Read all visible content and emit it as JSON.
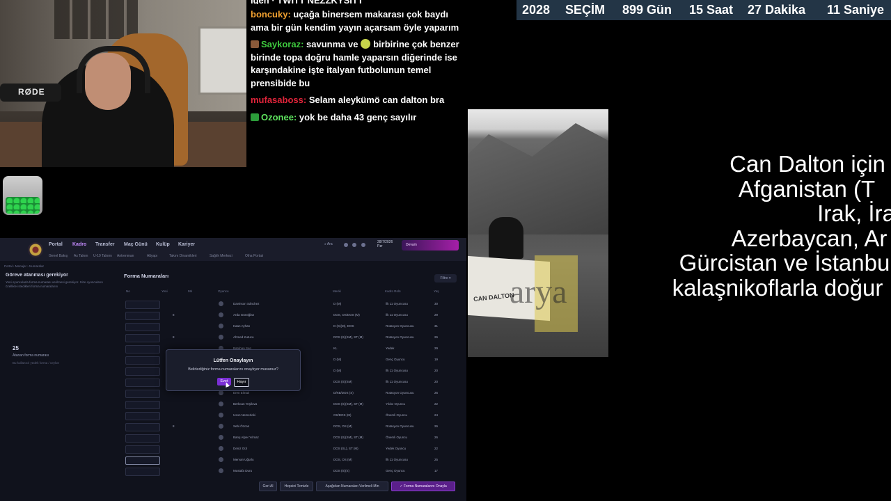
{
  "chat": {
    "messages": [
      {
        "user": "boncuky:",
        "text": "uçağa binersem makarası çok baydı ama bir gün kendim yayın açarsam öyle yaparım",
        "color": "#f0a030",
        "badge": ""
      },
      {
        "user": "Saykoraz:",
        "text": "savunma ve",
        "text2": "birbirine çok benzer birinde topa doğru hamle yaparsın diğerinde ise karşındakine işte italyan futbolunun temel prensibide bu",
        "color": "#3ec93e",
        "badge": "#8a5a3a"
      },
      {
        "user": "mufasaboss:",
        "text": "Selam aleykümö can dalton bra",
        "color": "#e0243a",
        "badge": ""
      },
      {
        "user": "Ozonee:",
        "text": "yok be daha 43 genç sayılır",
        "color": "#5ee35e",
        "badge": "#2c9c3a"
      }
    ]
  },
  "game": {
    "nav": [
      "Portal",
      "Kadro",
      "Transfer",
      "Maç Günü",
      "Kulüp",
      "Kariyer"
    ],
    "subnav": [
      "Genel Bakış",
      "As Takım",
      "U-19 Takımı",
      "Antrenman",
      "Altyapı",
      "Takım Dinamikleri",
      "Sağlık Merkezi",
      "Oiha Portalı"
    ],
    "search_label": "Ara",
    "date": "28/7/2026",
    "date_sub": "Pzr",
    "progress_label": "Devam",
    "breadcrumb": "Portal › Menajer › Numaralar",
    "left_title": "Göreve atanması gerekiyor",
    "left_desc": "Yeni oyuncularla forma numarası verilmesi gerekiyor. Size oyuncuların özellikle istedikleri forma numaralarını",
    "left_number": "25",
    "left_number_label": "Atanan forma numarası",
    "left_note": "Bu kullanıcıl yedek forma / ceylon",
    "table_title": "Forma Numaraları",
    "filter_label": "Filtre",
    "columns": [
      "No",
      "Yeni",
      "Mk",
      "Oyuncu",
      "Mevki",
      "Kadro Rolü",
      "Yaş"
    ],
    "rows": [
      {
        "name": "Davinson Sánchez",
        "pos": "D (M)",
        "role": "İlk 11 Oyuncusu",
        "age": "30",
        "mk": ""
      },
      {
        "name": "Arda Günöğlan",
        "pos": "DOS, OS/DOS (M)",
        "role": "İlk 11 Oyuncusu",
        "age": "29",
        "mk": "8"
      },
      {
        "name": "Kaan Ayhan",
        "pos": "D (S)(M), DOS",
        "role": "Rotasyon Oyuncusu",
        "age": "31",
        "mk": ""
      },
      {
        "name": "Ahmed Kutucu",
        "pos": "DOS (S)(SM), ST (M)",
        "role": "Rotasyon Oyuncusu",
        "age": "26",
        "mk": "8"
      },
      {
        "name": "Batuhan Şen",
        "pos": "KL",
        "role": "Yedek",
        "age": "29",
        "mk": ""
      },
      {
        "name": "Oyuncu",
        "pos": "D (M)",
        "role": "Genç Oyuncu",
        "age": "19",
        "mk": ""
      },
      {
        "name": "Oyuncu",
        "pos": "D (M)",
        "role": "İlk 11 Oyuncusu",
        "age": "20",
        "mk": ""
      },
      {
        "name": "Oyuncu",
        "pos": "DOS (S)(SM)",
        "role": "İlk 11 Oyuncusu",
        "age": "20",
        "mk": ""
      },
      {
        "name": "Eren Elmalı",
        "pos": "D/KB/DOS (S)",
        "role": "Rotasyon Oyuncusu",
        "age": "26",
        "mk": ""
      },
      {
        "name": "Berkcan Yeşilova",
        "pos": "DOS (S)(SM), ST (M)",
        "role": "Yıldız Oyuncu",
        "age": "22",
        "mk": ""
      },
      {
        "name": "Uson Nemerleki",
        "pos": "OS/DOS (M)",
        "role": "Önemli Oyuncu",
        "age": "24",
        "mk": ""
      },
      {
        "name": "Sebi Özcan",
        "pos": "DOS, OS (M)",
        "role": "Rotasyon Oyuncusu",
        "age": "26",
        "mk": "8"
      },
      {
        "name": "Barış Alper Yılmaz",
        "pos": "DOS (S)(SM), ST (M)",
        "role": "Önemli Oyuncu",
        "age": "26",
        "mk": ""
      },
      {
        "name": "Deniz Gül",
        "pos": "DOS (SL), ST (M)",
        "role": "Yedek Oyuncu",
        "age": "22",
        "mk": ""
      },
      {
        "name": "Mervan Uğurlu",
        "pos": "DOS, OS (M)",
        "role": "İlk 11 Oyuncusu",
        "age": "25",
        "mk": ""
      },
      {
        "name": "Mustafa Duru",
        "pos": "DOS (S)(S)",
        "role": "Genç Oyuncu",
        "age": "17",
        "mk": ""
      }
    ],
    "bottom_buttons": [
      "Geri Al",
      "Hepsini Temizle",
      "Aşağıdan Numaraları Verilmeli Min",
      "Forma Numaralarını Onayla"
    ],
    "dialog": {
      "title": "Lütfen Onaylayın",
      "message": "Belirlediğiniz forma numaralarını onaylıyor musunuz?",
      "yes": "Evet",
      "no": "Hayır"
    }
  },
  "countdown": {
    "year": "2028",
    "label": "SEÇİM",
    "days": "899 Gün",
    "hours": "15 Saat",
    "minutes": "27 Dakika",
    "seconds": "11 Saniye"
  },
  "video": {
    "banner_text": "CAN DALTON",
    "watermark": "arya"
  },
  "caption": {
    "lines": [
      "Can Dalton için",
      "Afganistan (T",
      "Irak, İra",
      "Azerbaycan, Ar",
      "Gürcistan ve İstanbu",
      "kalaşnikoflarla doğur"
    ]
  }
}
